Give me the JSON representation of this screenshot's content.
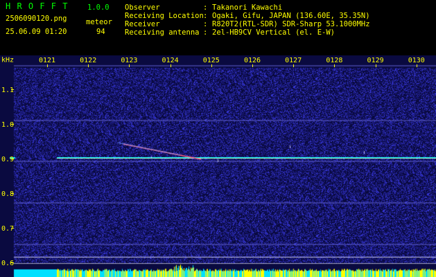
{
  "header": {
    "app_name": "H R O F F T",
    "version": "1.0.0",
    "filename": "2506090120.png",
    "label_meteor": "meteor",
    "datetime": "25.06.09 01:20",
    "meteor_count": "94",
    "info_labels": [
      "Observer",
      "Receiving Location",
      "Receiver",
      "Receiving antenna"
    ],
    "info_separator": ":",
    "info_values": [
      "Takanori Kawachi",
      "Ogaki, Gifu, JAPAN (136.60E, 35.35N)",
      "R820T2(RTL-SDR) SDR-Sharp 53.1000MHz",
      "2el-HB9CV Vertical (el. E-W)"
    ]
  },
  "spectrogram": {
    "unit_label": "kHz",
    "time_ticks": [
      "0121",
      "0122",
      "0123",
      "0124",
      "0125",
      "0126",
      "0127",
      "0128",
      "0129",
      "0130"
    ],
    "freq_ticks": [
      "1.1",
      "1.0",
      "0.9",
      "0.8",
      "0.7",
      "0.6"
    ],
    "colors": {
      "background": "#0a0a40",
      "noise": "#2a2aa0",
      "tick_text": "#ffff00",
      "header_text": "#00ff00",
      "signal": "#00ffff",
      "meteor": "#ff6080",
      "bar_yellow": "#ffff00",
      "bar_cyan": "#00e0ff"
    }
  }
}
